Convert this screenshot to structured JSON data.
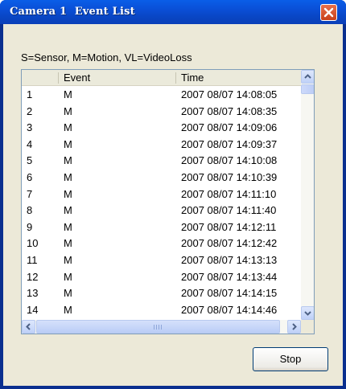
{
  "window": {
    "title": "Camera 1  Event List"
  },
  "legend": "S=Sensor, M=Motion, VL=VideoLoss",
  "table": {
    "columns": [
      "",
      "Event",
      "Time"
    ],
    "rows": [
      [
        "1",
        "M",
        "2007 08/07 14:08:05"
      ],
      [
        "2",
        "M",
        "2007 08/07 14:08:35"
      ],
      [
        "3",
        "M",
        "2007 08/07 14:09:06"
      ],
      [
        "4",
        "M",
        "2007 08/07 14:09:37"
      ],
      [
        "5",
        "M",
        "2007 08/07 14:10:08"
      ],
      [
        "6",
        "M",
        "2007 08/07 14:10:39"
      ],
      [
        "7",
        "M",
        "2007 08/07 14:11:10"
      ],
      [
        "8",
        "M",
        "2007 08/07 14:11:40"
      ],
      [
        "9",
        "M",
        "2007 08/07 14:12:11"
      ],
      [
        "10",
        "M",
        "2007 08/07 14:12:42"
      ],
      [
        "11",
        "M",
        "2007 08/07 14:13:13"
      ],
      [
        "12",
        "M",
        "2007 08/07 14:13:44"
      ],
      [
        "13",
        "M",
        "2007 08/07 14:14:15"
      ],
      [
        "14",
        "M",
        "2007 08/07 14:14:46"
      ]
    ]
  },
  "buttons": {
    "stop": "Stop"
  },
  "icons": {
    "close": "close-icon",
    "scroll_up": "chevron-up-icon",
    "scroll_down": "chevron-down-icon",
    "scroll_left": "chevron-left-icon",
    "scroll_right": "chevron-right-icon"
  },
  "colors": {
    "titlebar": "#0a4fd6",
    "close": "#d9542b",
    "client": "#ece9d8",
    "list_border": "#7f9db9"
  }
}
